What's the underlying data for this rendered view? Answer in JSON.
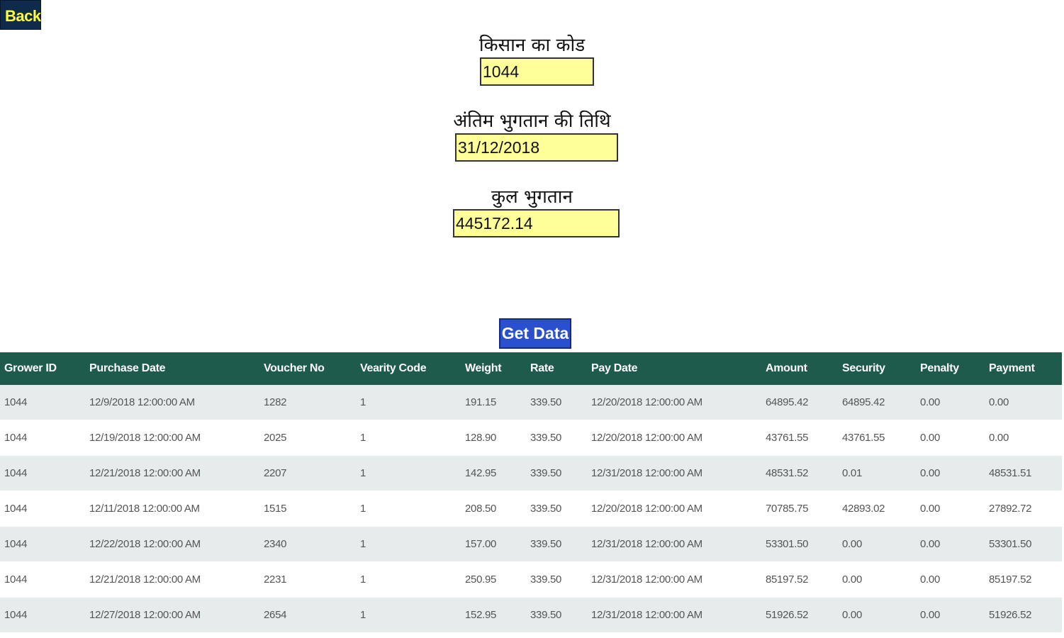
{
  "back_label": "Back",
  "fields": [
    {
      "label": "किसान का कोड",
      "value": "1044"
    },
    {
      "label": "अंतिम भुगतान की तिथि",
      "value": "31/12/2018"
    },
    {
      "label": "कुल भुगतान",
      "value": "445172.14"
    }
  ],
  "get_data_label": "Get Data",
  "table": {
    "headers": [
      "Grower ID",
      "Purchase Date",
      "Voucher No",
      "Vearity Code",
      "Weight",
      "Rate",
      "Pay Date",
      "Amount",
      "Security",
      "Penalty",
      "Payment"
    ],
    "rows": [
      [
        "1044",
        "12/9/2018 12:00:00 AM",
        "1282",
        "1",
        "191.15",
        "339.50",
        "12/20/2018 12:00:00 AM",
        "64895.42",
        "64895.42",
        "0.00",
        "0.00"
      ],
      [
        "1044",
        "12/19/2018 12:00:00 AM",
        "2025",
        "1",
        "128.90",
        "339.50",
        "12/20/2018 12:00:00 AM",
        "43761.55",
        "43761.55",
        "0.00",
        "0.00"
      ],
      [
        "1044",
        "12/21/2018 12:00:00 AM",
        "2207",
        "1",
        "142.95",
        "339.50",
        "12/31/2018 12:00:00 AM",
        "48531.52",
        "0.01",
        "0.00",
        "48531.51"
      ],
      [
        "1044",
        "12/11/2018 12:00:00 AM",
        "1515",
        "1",
        "208.50",
        "339.50",
        "12/20/2018 12:00:00 AM",
        "70785.75",
        "42893.02",
        "0.00",
        "27892.72"
      ],
      [
        "1044",
        "12/22/2018 12:00:00 AM",
        "2340",
        "1",
        "157.00",
        "339.50",
        "12/31/2018 12:00:00 AM",
        "53301.50",
        "0.00",
        "0.00",
        "53301.50"
      ],
      [
        "1044",
        "12/21/2018 12:00:00 AM",
        "2231",
        "1",
        "250.95",
        "339.50",
        "12/31/2018 12:00:00 AM",
        "85197.52",
        "0.00",
        "0.00",
        "85197.52"
      ],
      [
        "1044",
        "12/27/2018 12:00:00 AM",
        "2654",
        "1",
        "152.95",
        "339.50",
        "12/31/2018 12:00:00 AM",
        "51926.52",
        "0.00",
        "0.00",
        "51926.52"
      ]
    ]
  },
  "colors": {
    "header_bg": "#1f5b4d",
    "input_bg": "#ffff99",
    "button_bg": "#2a4fcf",
    "back_bg": "#0f2a4a",
    "back_text": "#ffff33"
  }
}
